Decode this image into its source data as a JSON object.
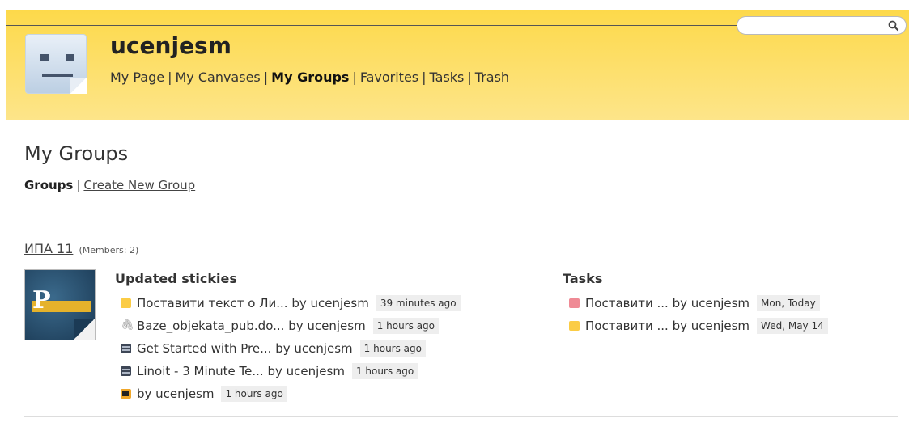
{
  "search": {
    "placeholder": "",
    "value": ""
  },
  "header": {
    "username": "ucenjesm",
    "nav": [
      {
        "label": "My Page",
        "active": false
      },
      {
        "label": "My Canvases",
        "active": false
      },
      {
        "label": "My Groups",
        "active": true
      },
      {
        "label": "Favorites",
        "active": false
      },
      {
        "label": "Tasks",
        "active": false
      },
      {
        "label": "Trash",
        "active": false
      }
    ]
  },
  "main": {
    "title": "My Groups",
    "subnav": {
      "groups_label": "Groups",
      "create_label": "Create New Group"
    }
  },
  "group": {
    "name": "ИПА 11",
    "members": "(Members: 2)",
    "thumb_letter": "Р",
    "updated_title": "Updated stickies",
    "updated": [
      {
        "icon": "sticky-yellow",
        "title": "Поставити текст о Ли...",
        "by": "by ucenjesm",
        "time": "39 minutes ago"
      },
      {
        "icon": "clip",
        "title": "Baze_objekata_pub.do...",
        "by": "by ucenjesm",
        "time": "1 hours ago"
      },
      {
        "icon": "film",
        "title": "Get Started with Pre...",
        "by": "by ucenjesm",
        "time": "1 hours ago"
      },
      {
        "icon": "film",
        "title": "Linoit - 3 Minute Te...",
        "by": "by ucenjesm",
        "time": "1 hours ago"
      },
      {
        "icon": "video",
        "title": "",
        "by": "by ucenjesm",
        "time": "1 hours ago"
      }
    ],
    "tasks_title": "Tasks",
    "tasks": [
      {
        "icon": "sticky-pink",
        "title": "Поставити ...",
        "by": "by ucenjesm",
        "time": "Mon, Today"
      },
      {
        "icon": "sticky-yellow",
        "title": "Поставити ...",
        "by": "by ucenjesm",
        "time": "Wed, May 14"
      }
    ]
  }
}
